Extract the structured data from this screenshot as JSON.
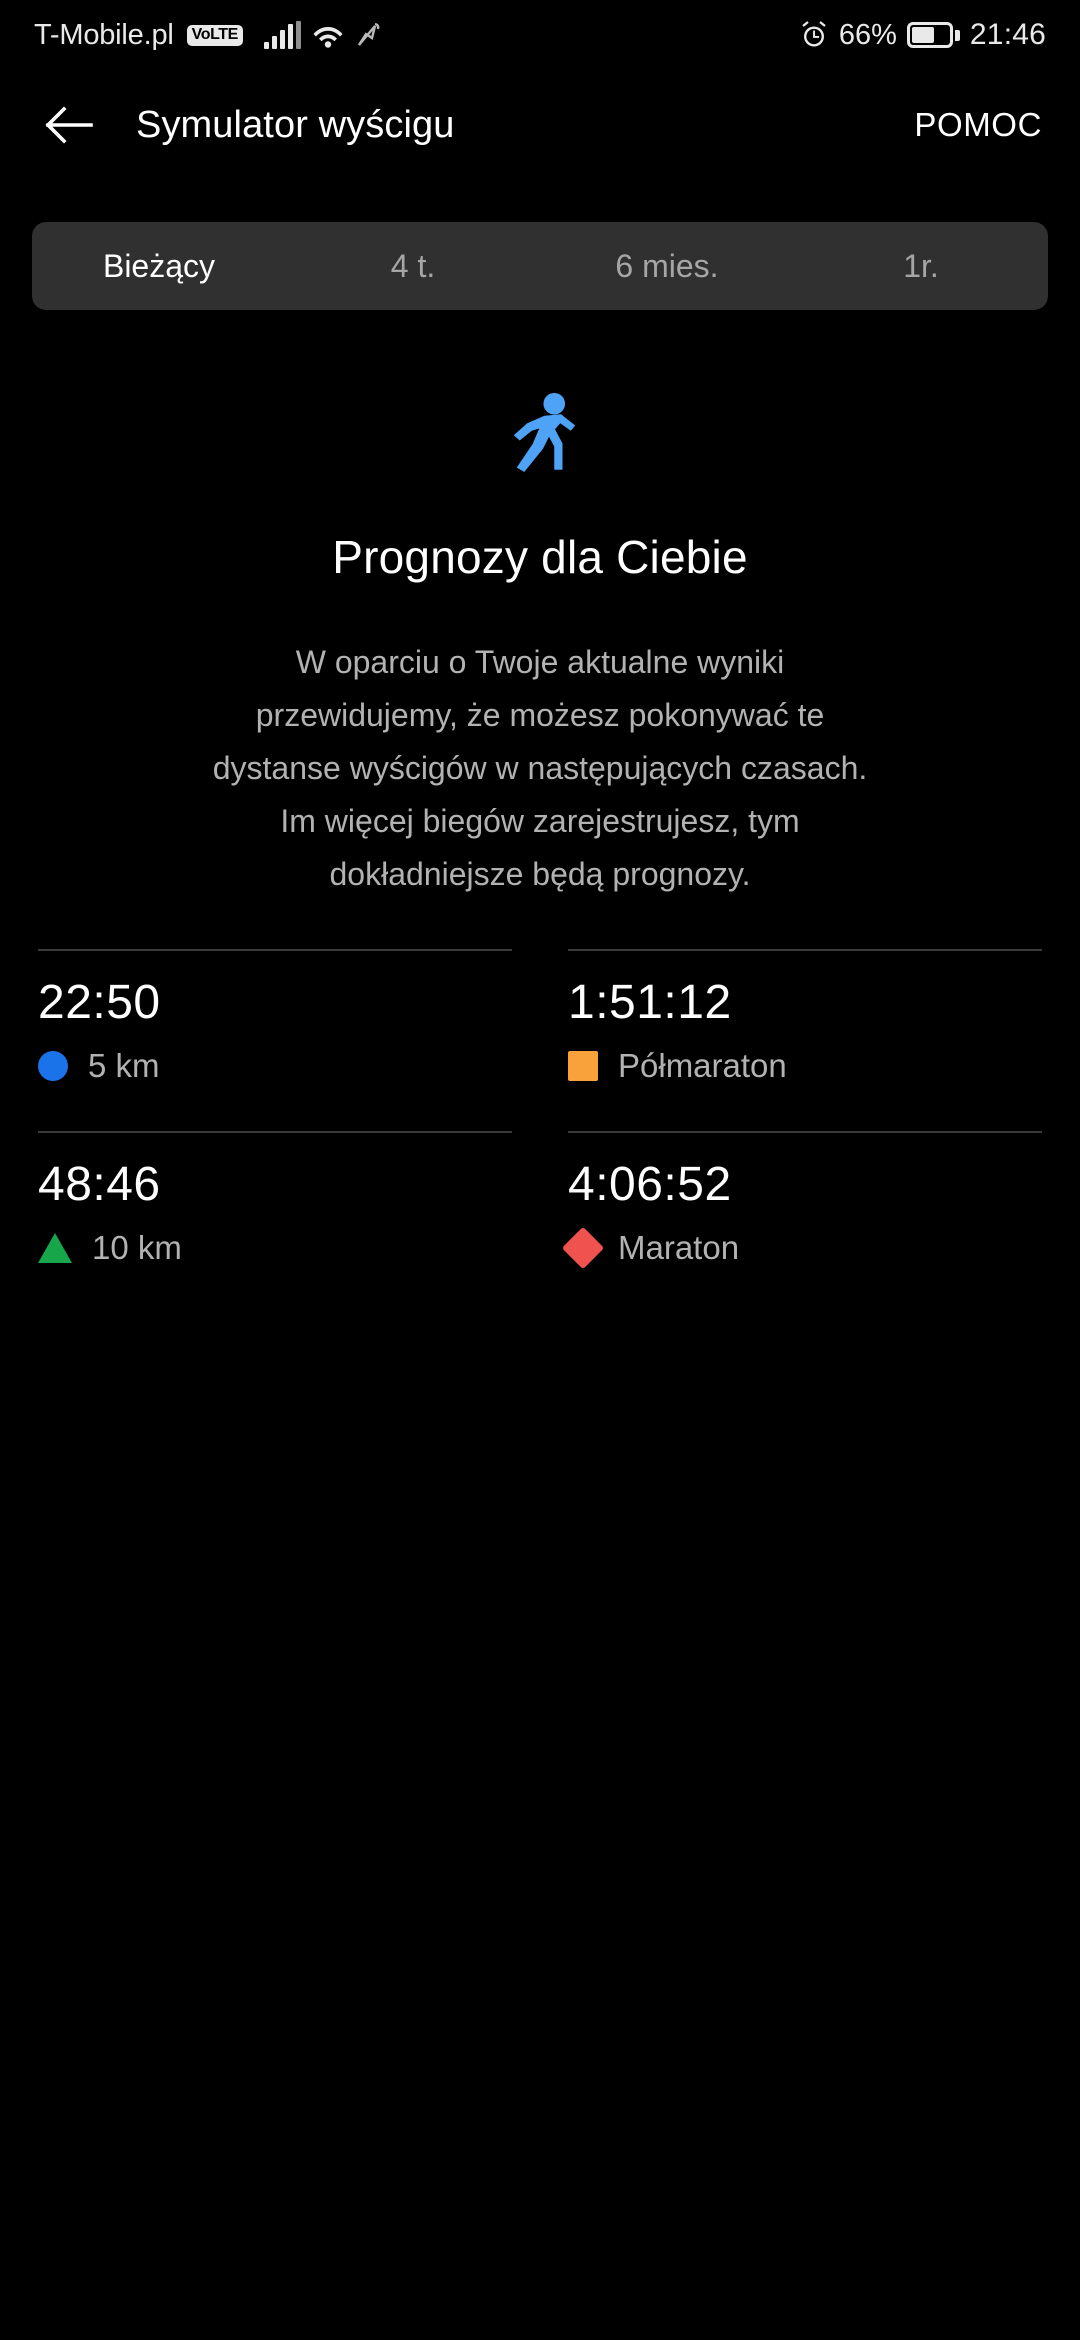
{
  "status_bar": {
    "carrier": "T-Mobile.pl",
    "volte_badge": "VoLTE",
    "battery_percent": "66%",
    "time": "21:46"
  },
  "app_bar": {
    "back_icon": "arrow-left-icon",
    "title": "Symulator wyścigu",
    "help_label": "POMOC"
  },
  "tabs": {
    "items": [
      {
        "label": "Bieżący",
        "selected": true
      },
      {
        "label": "4 t.",
        "selected": false
      },
      {
        "label": "6 mies.",
        "selected": false
      },
      {
        "label": "1r.",
        "selected": false
      }
    ]
  },
  "hero": {
    "icon": "running-person-icon",
    "icon_color": "#4FA3F7",
    "title": "Prognozy dla Ciebie",
    "description": "W oparciu o Twoje aktualne wyniki przewidujemy, że możesz pokonywać te dystanse wyścigów w następujących czasach. Im więcej biegów zarejestrujesz, tym dokładniejsze będą prognozy."
  },
  "predictions": [
    {
      "time": "22:50",
      "label": "5 km",
      "marker": "circle",
      "color": "#1A73E8"
    },
    {
      "time": "1:51:12",
      "label": "Półmaraton",
      "marker": "square",
      "color": "#F9A council"
    },
    {
      "time": "48:46",
      "label": "10 km",
      "marker": "triangle",
      "color": "#17A74A"
    },
    {
      "time": "4:06:52",
      "label": "Maraton",
      "marker": "diamond",
      "color": "#F0534F"
    }
  ]
}
